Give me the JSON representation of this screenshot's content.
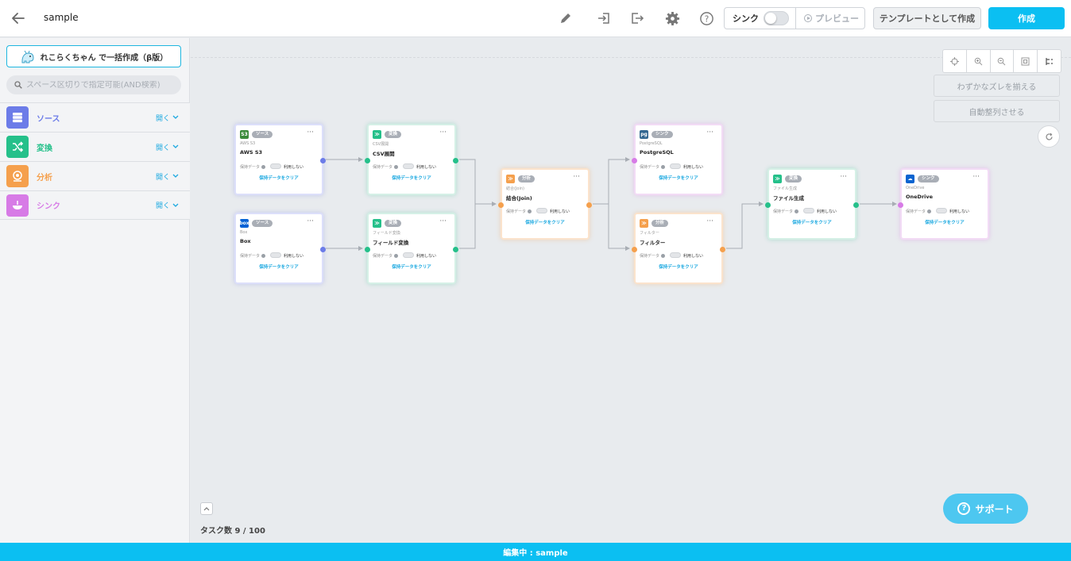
{
  "header": {
    "project_name": "sample",
    "sync_label": "シンク",
    "preview_label": "プレビュー",
    "template_label": "テンプレートとして作成",
    "create_label": "作成"
  },
  "sidebar": {
    "bulk_create_label": "れこらくちゃん で一括作成（β版）",
    "search_placeholder": "スペース区切りで指定可能(AND検索)",
    "categories": [
      {
        "label": "ソース",
        "open": "開く",
        "color": "#6c7ce8"
      },
      {
        "label": "変換",
        "open": "開く",
        "color": "#25c08a"
      },
      {
        "label": "分析",
        "open": "開く",
        "color": "#f5a04d"
      },
      {
        "label": "シンク",
        "open": "開く",
        "color": "#d77be6"
      }
    ]
  },
  "canvas": {
    "align_small_label": "わずかなズレを揃える",
    "auto_align_label": "自動整列させる",
    "task_count": "タスク数 9 / 100",
    "support_label": "サポート"
  },
  "nodes": [
    {
      "id": "awss3",
      "kind": "source",
      "badge": "ソース",
      "sub": "AWS S3",
      "title": "AWS S3",
      "icon_color": "#3b8b3b",
      "icon_text": "S3"
    },
    {
      "id": "box",
      "kind": "source",
      "badge": "ソース",
      "sub": "Box",
      "title": "Box",
      "icon_color": "#0061d5",
      "icon_text": "box"
    },
    {
      "id": "csv",
      "kind": "transform",
      "badge": "変換",
      "sub": "CSV展開",
      "title": "CSV展開",
      "icon_color": "#25c08a",
      "icon_text": "≫"
    },
    {
      "id": "field",
      "kind": "transform",
      "badge": "変換",
      "sub": "フィールド変換",
      "title": "フィールド変換",
      "icon_color": "#25c08a",
      "icon_text": "≫"
    },
    {
      "id": "join",
      "kind": "analysis",
      "badge": "分析",
      "sub": "結合(Join)",
      "title": "結合(Join)",
      "icon_color": "#f5a04d",
      "icon_text": "≫"
    },
    {
      "id": "postgres",
      "kind": "sink",
      "badge": "シンク",
      "sub": "PostgreSQL",
      "title": "PostgreSQL",
      "icon_color": "#336791",
      "icon_text": "pg"
    },
    {
      "id": "filter",
      "kind": "analysis",
      "badge": "分析",
      "sub": "フィルター",
      "title": "フィルター",
      "icon_color": "#f5a04d",
      "icon_text": "≫"
    },
    {
      "id": "filegen",
      "kind": "transform",
      "badge": "変換",
      "sub": "ファイル生成",
      "title": "ファイル生成",
      "icon_color": "#25c08a",
      "icon_text": "≫"
    },
    {
      "id": "onedrive",
      "kind": "sink",
      "badge": "シンク",
      "sub": "OneDrive",
      "title": "OneDrive",
      "icon_color": "#0a64d0",
      "icon_text": "☁"
    }
  ],
  "node_labels": {
    "hold_data": "保持データ",
    "unused": "利用しない",
    "clear": "保持データをクリア"
  },
  "footer": {
    "status": "編集中 : sample"
  }
}
